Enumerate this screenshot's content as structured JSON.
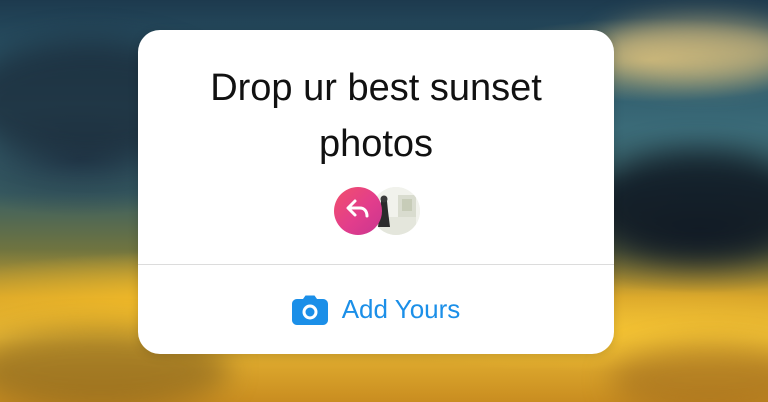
{
  "story_prompt": {
    "text": "Drop ur best sunset photos",
    "text_color": "#111111"
  },
  "participants": {
    "reply_icon": "reply-arrow-icon",
    "reply_gradient": [
      "#f2506b",
      "#c9368f"
    ],
    "photo": "user-photo-avatar"
  },
  "action": {
    "label": "Add Yours",
    "icon": "camera-icon",
    "color": "#1b8fe8"
  },
  "card": {
    "background": "#ffffff"
  }
}
